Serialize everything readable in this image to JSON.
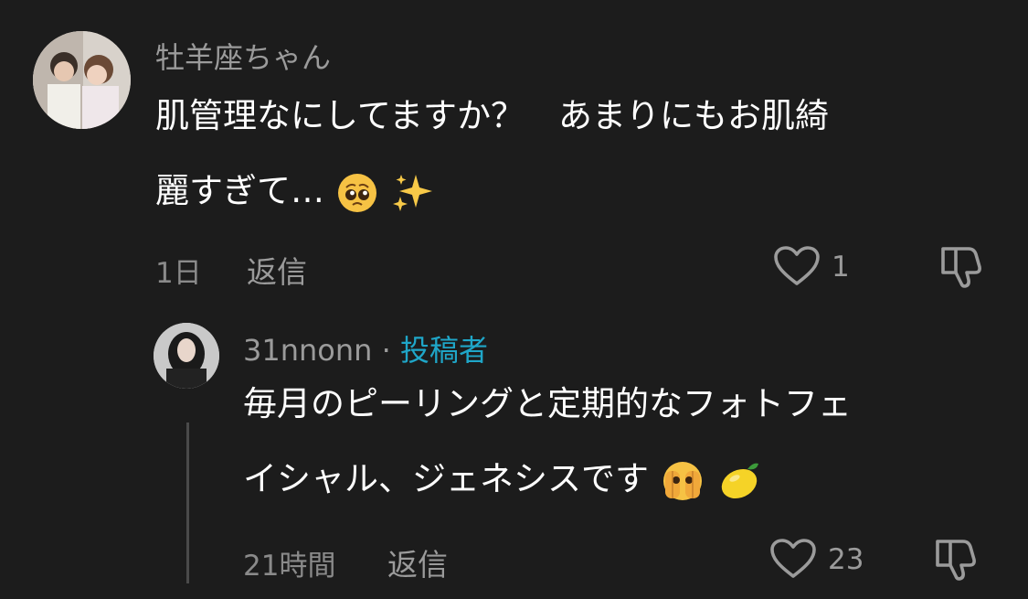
{
  "comments": [
    {
      "username": "牡羊座ちゃん",
      "text_line1": "肌管理なにしてますか？　あまりにもお肌綺",
      "text_line2": "麗すぎて…",
      "emojis": [
        "pleading-face-emoji",
        "sparkles-emoji"
      ],
      "time": "1日",
      "reply_label": "返信",
      "likes": "1"
    }
  ],
  "reply": {
    "username": "31nnonn",
    "separator": "·",
    "author_tag": "投稿者",
    "text_line1": "毎月のピーリングと定期的なフォトフェ",
    "text_line2": "イシャル、ジェネシスです",
    "emojis": [
      "face-with-peeking-eye-emoji",
      "lemon-emoji"
    ],
    "time": "21時間",
    "reply_label": "返信",
    "likes": "23"
  },
  "icons": {
    "like": "heart-outline-icon",
    "dislike": "thumbs-down-icon"
  },
  "colors": {
    "background": "#1c1c1c",
    "author_tag": "#1fa6c8",
    "secondary_text": "#9b9b9b"
  }
}
